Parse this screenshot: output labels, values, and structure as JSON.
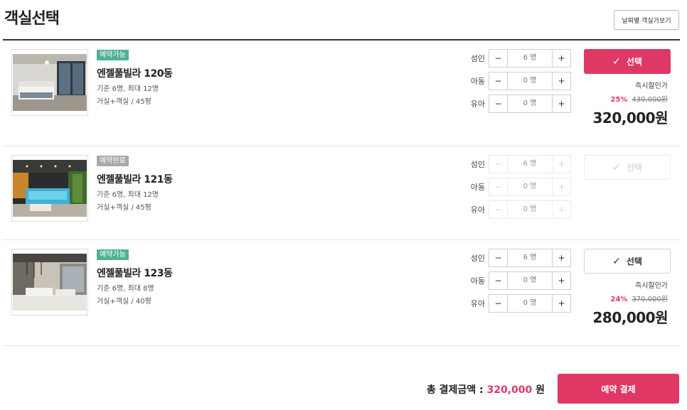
{
  "header": {
    "title": "객실선택",
    "date_view_label": "날짜별 객실가보기"
  },
  "counter_labels": {
    "adult": "성인",
    "child": "아동",
    "infant": "유아"
  },
  "stepper_icons": {
    "minus": "minus-icon",
    "plus": "plus-icon",
    "minus_glyph": "−",
    "plus_glyph": "+"
  },
  "rooms": [
    {
      "status": "예약가능",
      "status_color": "#52b096",
      "name": "엔젤풀빌라 120동",
      "capacity": "기준 6명, 최대 12명",
      "layout": "거실+객실 / 45평",
      "counts": {
        "adult": "6 명",
        "child": "0 명",
        "infant": "0 명"
      },
      "select_label": "선택",
      "select_state": "selected",
      "discount_label": "즉시할인가",
      "discount_rate": "25%",
      "original_price": "430,000원",
      "price": "320,000원"
    },
    {
      "status": "예약완료",
      "status_color": "#a9a9a9",
      "name": "엔젤풀빌라 121동",
      "capacity": "기준 6명, 최대 12명",
      "layout": "거실+객실 / 45평",
      "counts": {
        "adult": "6 명",
        "child": "0 명",
        "infant": "0 명"
      },
      "select_label": "선택",
      "select_state": "disabled"
    },
    {
      "status": "예약가능",
      "status_color": "#52b096",
      "name": "엔젤풀빌라 123동",
      "capacity": "기준 6명, 최대 8명",
      "layout": "거실+객실 / 40평",
      "counts": {
        "adult": "6 명",
        "child": "0 명",
        "infant": "0 명"
      },
      "select_label": "선택",
      "select_state": "available",
      "discount_label": "즉시할인가",
      "discount_rate": "24%",
      "original_price": "370,000원",
      "price": "280,000원"
    }
  ],
  "footer": {
    "total_label": "총 결제금액 :",
    "total_amount": "320,000",
    "total_unit": "원",
    "reserve_label": "예약 결제"
  },
  "colors": {
    "accent": "#e03864",
    "available_badge": "#52b096",
    "booked_badge": "#a9a9a9"
  }
}
